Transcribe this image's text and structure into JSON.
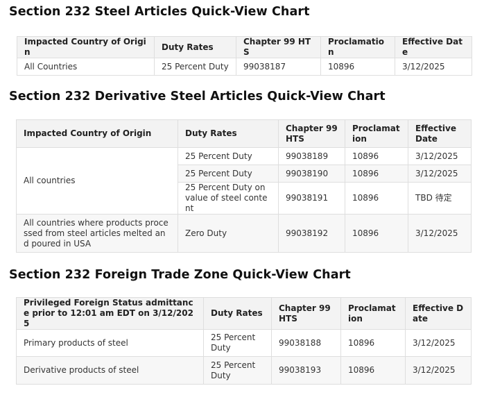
{
  "sections": [
    {
      "title": "Section 232 Steel Articles Quick-View Chart",
      "headers": [
        "Impacted Country of Origin",
        "Duty Rates",
        "Chapter 99 HTS",
        "Proclamation",
        "Effective Date"
      ],
      "rows": [
        [
          "All Countries",
          "25 Percent Duty",
          "99038187",
          "10896",
          "3/12/2025"
        ]
      ]
    },
    {
      "title": "Section 232 Derivative Steel Articles Quick-View Chart",
      "headers": [
        "Impacted Country of Origin",
        "Duty Rates",
        "Chapter 99 HTS",
        "Proclamation",
        "Effective Date"
      ],
      "group_label": "All countries",
      "rows": [
        [
          "25 Percent Duty",
          "99038189",
          "10896",
          "3/12/2025"
        ],
        [
          "25 Percent Duty",
          "99038190",
          "10896",
          "3/12/2025"
        ],
        [
          "25 Percent Duty on value of steel content",
          "99038191",
          "10896",
          "TBD 待定"
        ]
      ],
      "last_row": [
        "All countries where products processed from steel articles melted and poured in USA",
        "Zero Duty",
        "99038192",
        "10896",
        "3/12/2025"
      ]
    },
    {
      "title": "Section 232 Foreign Trade Zone Quick-View Chart",
      "headers": [
        "Privileged Foreign Status admittance prior to 12:01 am EDT on 3/12/2025",
        "Duty Rates",
        "Chapter 99 HTS",
        "Proclamation",
        "Effective Date"
      ],
      "rows": [
        [
          "Primary products of steel",
          "25 Percent Duty",
          "99038188",
          "10896",
          "3/12/2025"
        ],
        [
          "Derivative products of steel",
          "25 Percent Duty",
          "99038193",
          "10896",
          "3/12/2025"
        ]
      ]
    }
  ]
}
